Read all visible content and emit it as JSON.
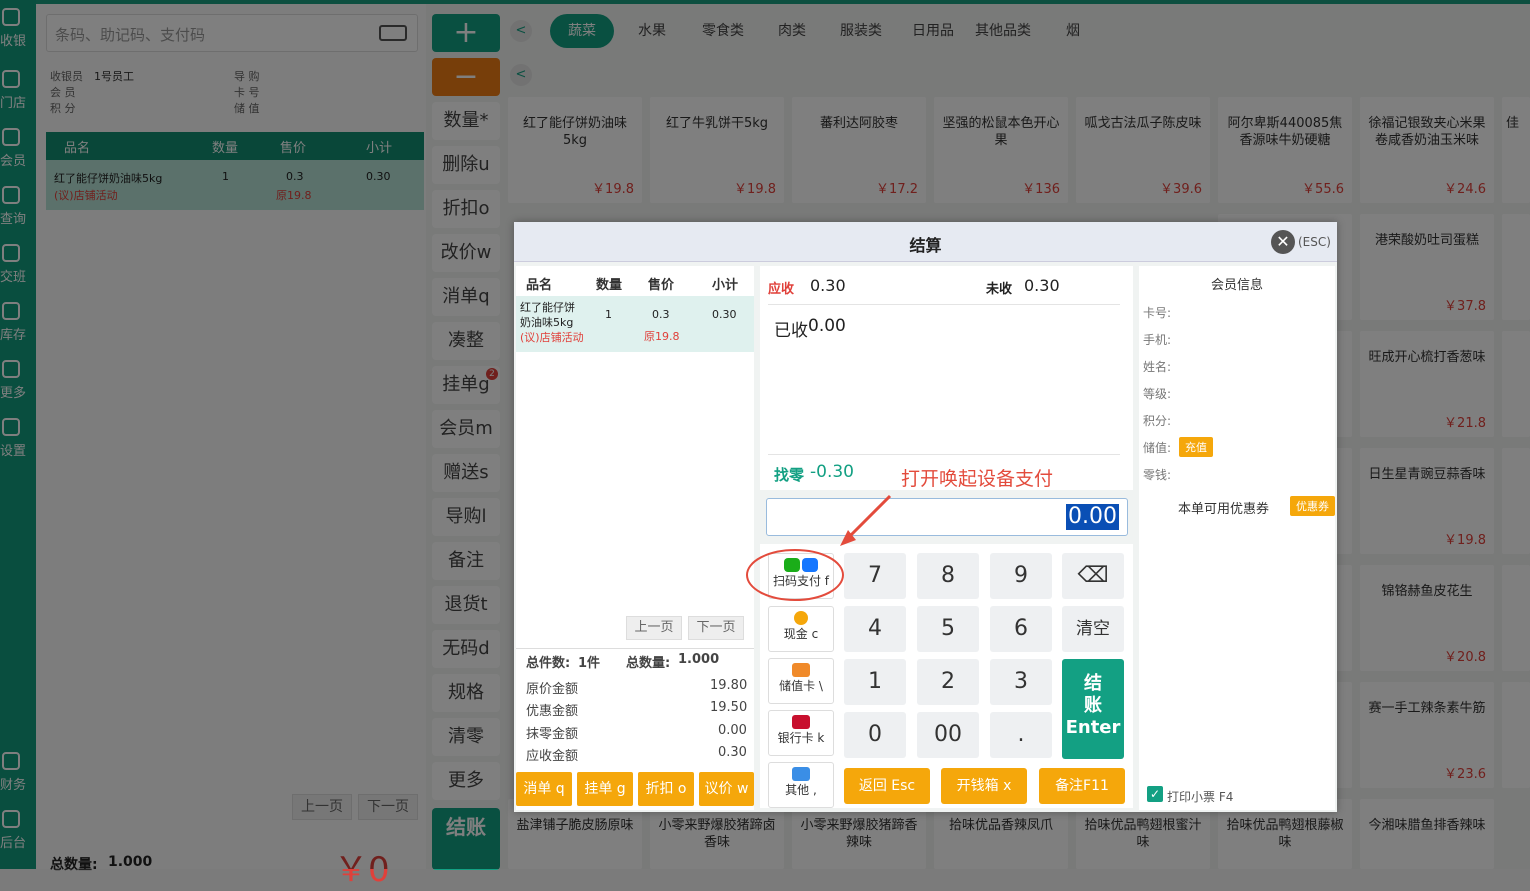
{
  "left_nav": [
    {
      "label": "收银",
      "icon": "cashier-icon"
    },
    {
      "label": "门店",
      "icon": "store-icon"
    },
    {
      "label": "会员",
      "icon": "member-icon"
    },
    {
      "label": "查询",
      "icon": "query-icon"
    },
    {
      "label": "交班",
      "icon": "shift-icon"
    },
    {
      "label": "库存",
      "icon": "stock-icon"
    },
    {
      "label": "更多",
      "icon": "more-icon"
    },
    {
      "label": "设置",
      "icon": "settings-icon"
    },
    {
      "label": "财务",
      "icon": "finance-icon"
    },
    {
      "label": "后台",
      "icon": "backend-icon"
    }
  ],
  "search": {
    "placeholder": "条码、助记码、支付码"
  },
  "cashier_info": {
    "cashier_label": "收银员",
    "cashier_value": "1号员工",
    "member_label": "会 员",
    "points_label": "积 分",
    "guide_label": "导 购",
    "card_label": "卡 号",
    "balance_label": "储 值"
  },
  "cart": {
    "headers": [
      "品名",
      "数量",
      "售价",
      "小计"
    ],
    "rows": [
      {
        "name": "红了能仔饼奶油味5kg",
        "tag": "(议)店铺活动",
        "qty": "1",
        "price": "0.3",
        "orig": "原19.8",
        "subtotal": "0.30"
      }
    ],
    "prev": "上一页",
    "next": "下一页",
    "total_label": "总数量:",
    "total_value": "1.000",
    "total_amount": "￥0"
  },
  "ops": [
    "数量*",
    "删除u",
    "折扣o",
    "改价w",
    "消单q",
    "凑整",
    "挂单g",
    "会员m",
    "赠送s",
    "导购l",
    "备注",
    "退货t",
    "无码d",
    "规格",
    "清零",
    "更多",
    "结账"
  ],
  "ops_badge": "2",
  "categories": [
    "蔬菜",
    "水果",
    "零食类",
    "肉类",
    "服装类",
    "日用品",
    "其他品类",
    "烟"
  ],
  "products": [
    {
      "name": "红了能仔饼奶油味5kg",
      "price": "￥19.8"
    },
    {
      "name": "红了牛乳饼干5kg",
      "price": "￥19.8"
    },
    {
      "name": "蕃利达阿胶枣",
      "price": "￥17.2"
    },
    {
      "name": "坚强的松鼠本色开心果",
      "price": "￥136"
    },
    {
      "name": "呱戈古法瓜子陈皮味",
      "price": "￥39.6"
    },
    {
      "name": "阿尔卑斯440085焦香源味牛奶硬糖",
      "price": "￥55.6"
    },
    {
      "name": "徐福记银致夹心米果卷咸香奶油玉米味",
      "price": "￥24.6"
    },
    {
      "name": "佳",
      "price": ""
    }
  ],
  "products_right": [
    {
      "name": "港荣酸奶吐司蛋糕",
      "price": "￥37.8"
    },
    {
      "name": "旺成开心梳打香葱味",
      "price": "￥21.8"
    },
    {
      "name": "日生星青豌豆蒜香味",
      "price": "￥19.8"
    },
    {
      "name": "锦铬赫鱼皮花生",
      "price": "￥20.8"
    },
    {
      "name": "赛一手工辣条素牛筋",
      "price": "￥23.6"
    },
    {
      "name": "今湘味腊鱼排香辣味",
      "price": ""
    }
  ],
  "products_bottom": [
    "盐津铺子脆皮肠原味",
    "小零来野爆胶猪蹄卤香味",
    "小零来野爆胶猪蹄香辣味",
    "拾味优品香辣凤爪",
    "拾味优品鸭翅根蜜汁味",
    "拾味优品鸭翅根藤椒味"
  ],
  "dialog": {
    "title": "结算",
    "esc": "(ESC)",
    "headers": [
      "品名",
      "数量",
      "售价",
      "小计"
    ],
    "row": {
      "name": "红了能仔饼奶油味5kg",
      "tag": "(议)店铺活动",
      "qty": "1",
      "price": "0.3",
      "orig": "原19.8",
      "subtotal": "0.30"
    },
    "prev": "上一页",
    "next": "下一页",
    "total_items_label": "总件数:",
    "total_items": "1件",
    "total_qty_label": "总数量:",
    "total_qty": "1.000",
    "summary": [
      {
        "label": "原价金额",
        "value": "19.80"
      },
      {
        "label": "优惠金额",
        "value": "19.50"
      },
      {
        "label": "抹零金额",
        "value": "0.00"
      },
      {
        "label": "应收金额",
        "value": "0.30"
      }
    ],
    "bottom_btns": [
      "消单 q",
      "挂单 g",
      "折扣 o",
      "议价 w"
    ],
    "due_label": "应收",
    "due_value": "0.30",
    "unpaid_label": "未收",
    "unpaid_value": "0.30",
    "paid_label": "已收",
    "paid_value": "0.00",
    "change_label": "找零",
    "change_value": "-0.30",
    "input_value": "0.00",
    "pay_methods": [
      "扫码支付 f",
      "现金 c",
      "储值卡 \\",
      "银行卡 k",
      "其他 ,"
    ],
    "keys": [
      "7",
      "8",
      "9",
      "4",
      "5",
      "6",
      "1",
      "2",
      "3",
      "0",
      "00",
      "."
    ],
    "clear": "清空",
    "enter": [
      "结",
      "账",
      "Enter"
    ],
    "actions": [
      "返回 Esc",
      "开钱箱 x",
      "备注F11"
    ],
    "member_title": "会员信息",
    "member_fields": [
      "卡号:",
      "手机:",
      "姓名:",
      "等级:",
      "积分:",
      "储值:",
      "零钱:"
    ],
    "recharge": "充值",
    "coupon_label": "本单可用优惠券",
    "coupon_btn": "优惠券",
    "print_label": "打印小票 F4"
  },
  "annotation": "打开唤起设备支付",
  "colors": {
    "primary": "#13a083",
    "accent": "#f5a70b",
    "danger": "#e0403a"
  }
}
